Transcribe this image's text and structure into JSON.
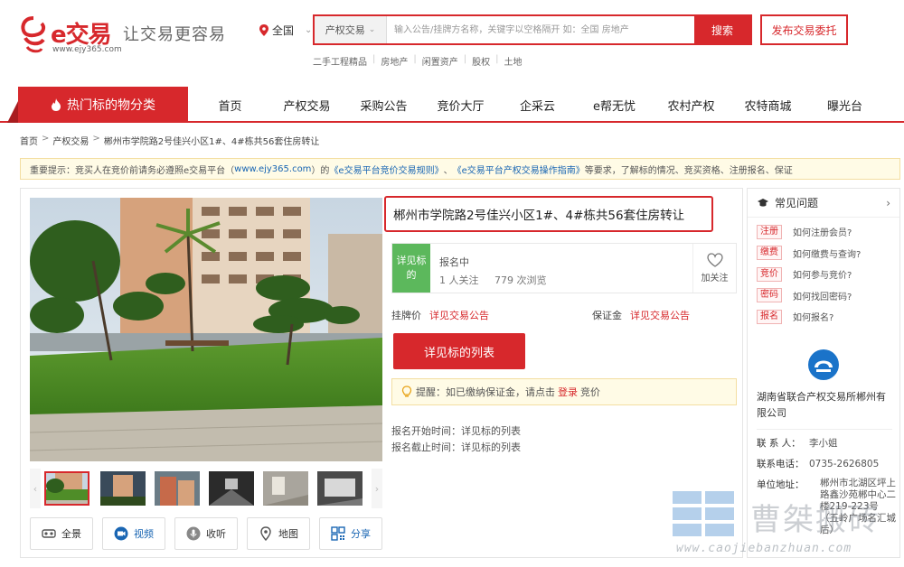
{
  "header": {
    "brand": "e交易",
    "slogan": "让交易更容易",
    "url": "www.ejy365.com",
    "region": "全国",
    "search_type": "产权交易",
    "search_placeholder": "输入公告/挂牌方名称，关键字以空格隔开 如：全国 房地产",
    "search_button": "搜索",
    "publish_button": "发布交易委托",
    "hotlinks": [
      "二手工程精品",
      "房地产",
      "闲置资产",
      "股权",
      "土地"
    ]
  },
  "nav": {
    "hot": "热门标的物分类",
    "items": [
      "首页",
      "产权交易",
      "采购公告",
      "竞价大厅",
      "企采云",
      "e帮无忧",
      "农村产权",
      "农特商城",
      "曝光台"
    ]
  },
  "breadcrumb": [
    "首页",
    "产权交易",
    "郴州市学院路2号佳兴小区1#、4#栋共56套住房转让"
  ],
  "notice": {
    "prefix": "重要提示：竞买人在竞价前请务必遵照e交易平台（",
    "link1": "www.ejy365.com",
    "mid1": "）的",
    "link2": "《e交易平台竞价交易规则》",
    "mid2": "、",
    "link3": "《e交易平台产权交易操作指南》",
    "suffix": "等要求，了解标的情况、竞买资格、注册报名、保证"
  },
  "listing": {
    "title": "郴州市学院路2号佳兴小区1#、4#栋共56套住房转让",
    "status_tag": "详见标的",
    "status": "报名中",
    "followers": "1 人关注",
    "views": "779 次浏览",
    "follow_label": "加关注",
    "price_label": "挂牌价",
    "price_value": "详见交易公告",
    "deposit_label": "保证金",
    "deposit_value": "详见交易公告",
    "detail_button": "详见标的列表",
    "tip_prefix": "提醒：如已缴纳保证金，请点击",
    "tip_login": "登录",
    "tip_suffix": "竞价",
    "start_label": "报名开始时间：",
    "start_value": "详见标的列表",
    "end_label": "报名截止时间：",
    "end_value": "详见标的列表"
  },
  "actions": [
    {
      "label": "全景",
      "icon": "vr-glasses-icon"
    },
    {
      "label": "视频",
      "icon": "video-camera-icon"
    },
    {
      "label": "收听",
      "icon": "microphone-icon"
    },
    {
      "label": "地图",
      "icon": "map-pin-icon"
    },
    {
      "label": "分享",
      "icon": "qr-code-icon"
    }
  ],
  "faq": {
    "title": "常见问题",
    "items": [
      {
        "tag": "注册",
        "text": "如何注册会员?"
      },
      {
        "tag": "缴费",
        "text": "如何缴费与查询?"
      },
      {
        "tag": "竞价",
        "text": "如何参与竞价?"
      },
      {
        "tag": "密码",
        "text": "如何找回密码?"
      },
      {
        "tag": "报名",
        "text": "如何报名?"
      }
    ]
  },
  "org": {
    "name": "湖南省联合产权交易所郴州有限公司",
    "contact_label": "联 系 人：",
    "contact_value": "李小姐",
    "phone_label": "联系电话：",
    "phone_value": "0735-2626805",
    "address_label": "单位地址：",
    "address_value": "郴州市北湖区坪上路鑫沙苑郴中心二楼219-223号（五岭广场名汇城后）"
  },
  "watermark": {
    "text": "曹桀搬砖",
    "url": "www.caojiebanzhuan.com"
  },
  "colors": {
    "accent": "#d7282c",
    "link": "#1a66b3",
    "status_green": "#5cb85c"
  }
}
